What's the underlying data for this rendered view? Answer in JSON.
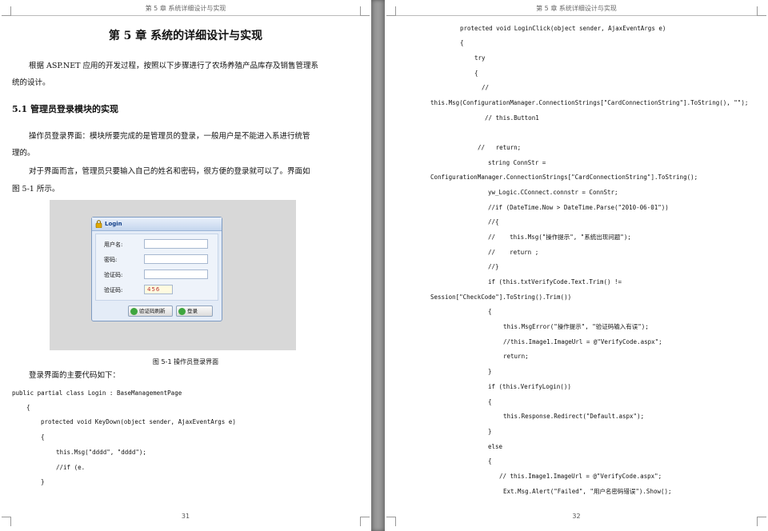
{
  "left_page": {
    "running_head": "第 5 章  系统详细设计与实现",
    "chapter_title": "第 5 章  系统的详细设计与实现",
    "intro_line1": "根据 ASP.NET 应用的开发过程，按照以下步骤进行了农场养殖产品库存及销售管理系",
    "intro_line2": "统的设计。",
    "section_title": "5.1  管理员登录模块的实现",
    "para1_line1": "操作员登录界面：模块所要完成的是管理员的登录，一般用户是不能进入系进行统管",
    "para1_line2": "理的。",
    "para2_line1": "对于界面而言，管理员只要输入自己的姓名和密码，很方便的登录就可以了。界面如",
    "para2_line2": "图 5-1 所示。",
    "login": {
      "title": "Login",
      "username_label": "用户名:",
      "password_label": "密码:",
      "verify_label": "验证码:",
      "verify_image_label": "验证码:",
      "captcha_text": "456",
      "refresh_button": "验证码刷新",
      "login_button": "登录"
    },
    "figure_caption": "图 5-1  操作员登录界面",
    "code_intro": "登录界面的主要代码如下：",
    "code_lines": [
      "public partial class Login : BaseManagementPage",
      "{",
      "protected void KeyDown(object sender, AjaxEventArgs e)",
      "{",
      "this.Msg(\"dddd\", \"dddd\");",
      "//if (e.",
      "}"
    ],
    "page_number": "31"
  },
  "right_page": {
    "running_head": "第 5 章  系统详细设计与实现",
    "code_lines": [
      "protected void LoginClick(object sender, AjaxEventArgs e)",
      "{",
      "try",
      "{",
      "//",
      "this.Msg(ConfigurationManager.ConnectionStrings[\"CardConnectionString\"].ToString(), \"\");",
      "// this.Button1",
      "//   return;",
      "string ConnStr =",
      "ConfigurationManager.ConnectionStrings[\"CardConnectionString\"].ToString();",
      "yw_Logic.CConnect.connstr = ConnStr;",
      "//if (DateTime.Now > DateTime.Parse(\"2010-06-01\"))",
      "//{",
      "//    this.Msg(\"操作提示\", \"系统出现问题\");",
      "//    return ;",
      "//}",
      "if (this.txtVerifyCode.Text.Trim() !=",
      "Session[\"CheckCode\"].ToString().Trim())",
      "{",
      "this.MsgError(\"操作提示\", \"验证码输入有误\");",
      "//this.Image1.ImageUrl = @\"VerifyCode.aspx\";",
      "return;",
      "}",
      "if (this.VerifyLogin())",
      "{",
      "this.Response.Redirect(\"Default.aspx\");",
      "}",
      "else",
      "{",
      "// this.Image1.ImageUrl = @\"VerifyCode.aspx\";",
      "Ext.Msg.Alert(\"Failed\", \"用户名密码错误\").Show();"
    ],
    "page_number": "32"
  }
}
